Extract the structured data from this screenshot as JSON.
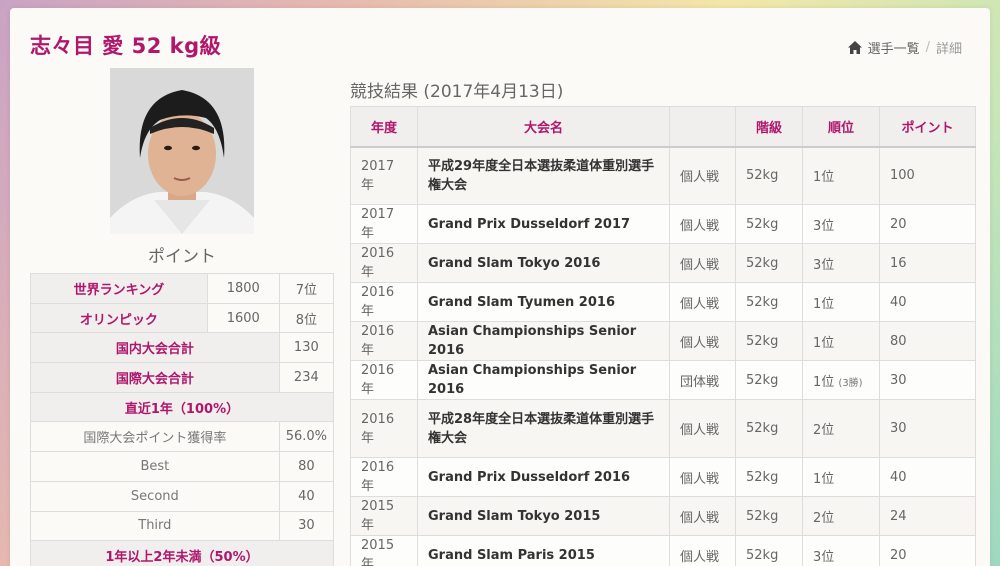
{
  "header": {
    "title": "志々目 愛 52 kg級",
    "breadcrumb": {
      "list": "選手一覧",
      "current": "詳細"
    }
  },
  "profile": {
    "points_label": "ポイント",
    "rankings": [
      {
        "label": "世界ランキング",
        "points": "1800",
        "rank": "7位"
      },
      {
        "label": "オリンピック",
        "points": "1600",
        "rank": "8位"
      }
    ],
    "totals": [
      {
        "label": "国内大会合計",
        "value": "130"
      },
      {
        "label": "国際大会合計",
        "value": "234"
      }
    ],
    "recent": {
      "title": "直近1年（100%）",
      "rows": [
        {
          "label": "国際大会ポイント獲得率",
          "value": "56.0%"
        },
        {
          "label": "Best",
          "value": "80"
        },
        {
          "label": "Second",
          "value": "40"
        },
        {
          "label": "Third",
          "value": "30"
        }
      ]
    },
    "older_title": "1年以上2年未満（50%）"
  },
  "results": {
    "title": "競技結果 (2017年4月13日)",
    "headers": [
      "年度",
      "大会名",
      "",
      "階級",
      "順位",
      "ポイント"
    ],
    "rows": [
      {
        "year": "2017年",
        "name": "平成29年度全日本選抜柔道体重別選手権大会",
        "type": "個人戦",
        "weight": "52kg",
        "rank": "1位",
        "note": "",
        "points": "100"
      },
      {
        "year": "2017年",
        "name": "Grand Prix Dusseldorf 2017",
        "type": "個人戦",
        "weight": "52kg",
        "rank": "3位",
        "note": "",
        "points": "20"
      },
      {
        "year": "2016年",
        "name": "Grand Slam Tokyo 2016",
        "type": "個人戦",
        "weight": "52kg",
        "rank": "3位",
        "note": "",
        "points": "16"
      },
      {
        "year": "2016年",
        "name": "Grand Slam Tyumen 2016",
        "type": "個人戦",
        "weight": "52kg",
        "rank": "1位",
        "note": "",
        "points": "40"
      },
      {
        "year": "2016年",
        "name": "Asian Championships Senior 2016",
        "type": "個人戦",
        "weight": "52kg",
        "rank": "1位",
        "note": "",
        "points": "80"
      },
      {
        "year": "2016年",
        "name": "Asian Championships Senior 2016",
        "type": "団体戦",
        "weight": "52kg",
        "rank": "1位",
        "note": "(3勝)",
        "points": "30"
      },
      {
        "year": "2016年",
        "name": "平成28年度全日本選抜柔道体重別選手権大会",
        "type": "個人戦",
        "weight": "52kg",
        "rank": "2位",
        "note": "",
        "points": "30"
      },
      {
        "year": "2016年",
        "name": "Grand Prix Dusseldorf 2016",
        "type": "個人戦",
        "weight": "52kg",
        "rank": "1位",
        "note": "",
        "points": "40"
      },
      {
        "year": "2015年",
        "name": "Grand Slam Tokyo 2015",
        "type": "個人戦",
        "weight": "52kg",
        "rank": "2位",
        "note": "",
        "points": "24"
      },
      {
        "year": "2015年",
        "name": "Grand Slam Paris 2015",
        "type": "個人戦",
        "weight": "52kg",
        "rank": "3位",
        "note": "",
        "points": "20"
      }
    ]
  },
  "colors": {
    "accent": "#b0166b"
  }
}
